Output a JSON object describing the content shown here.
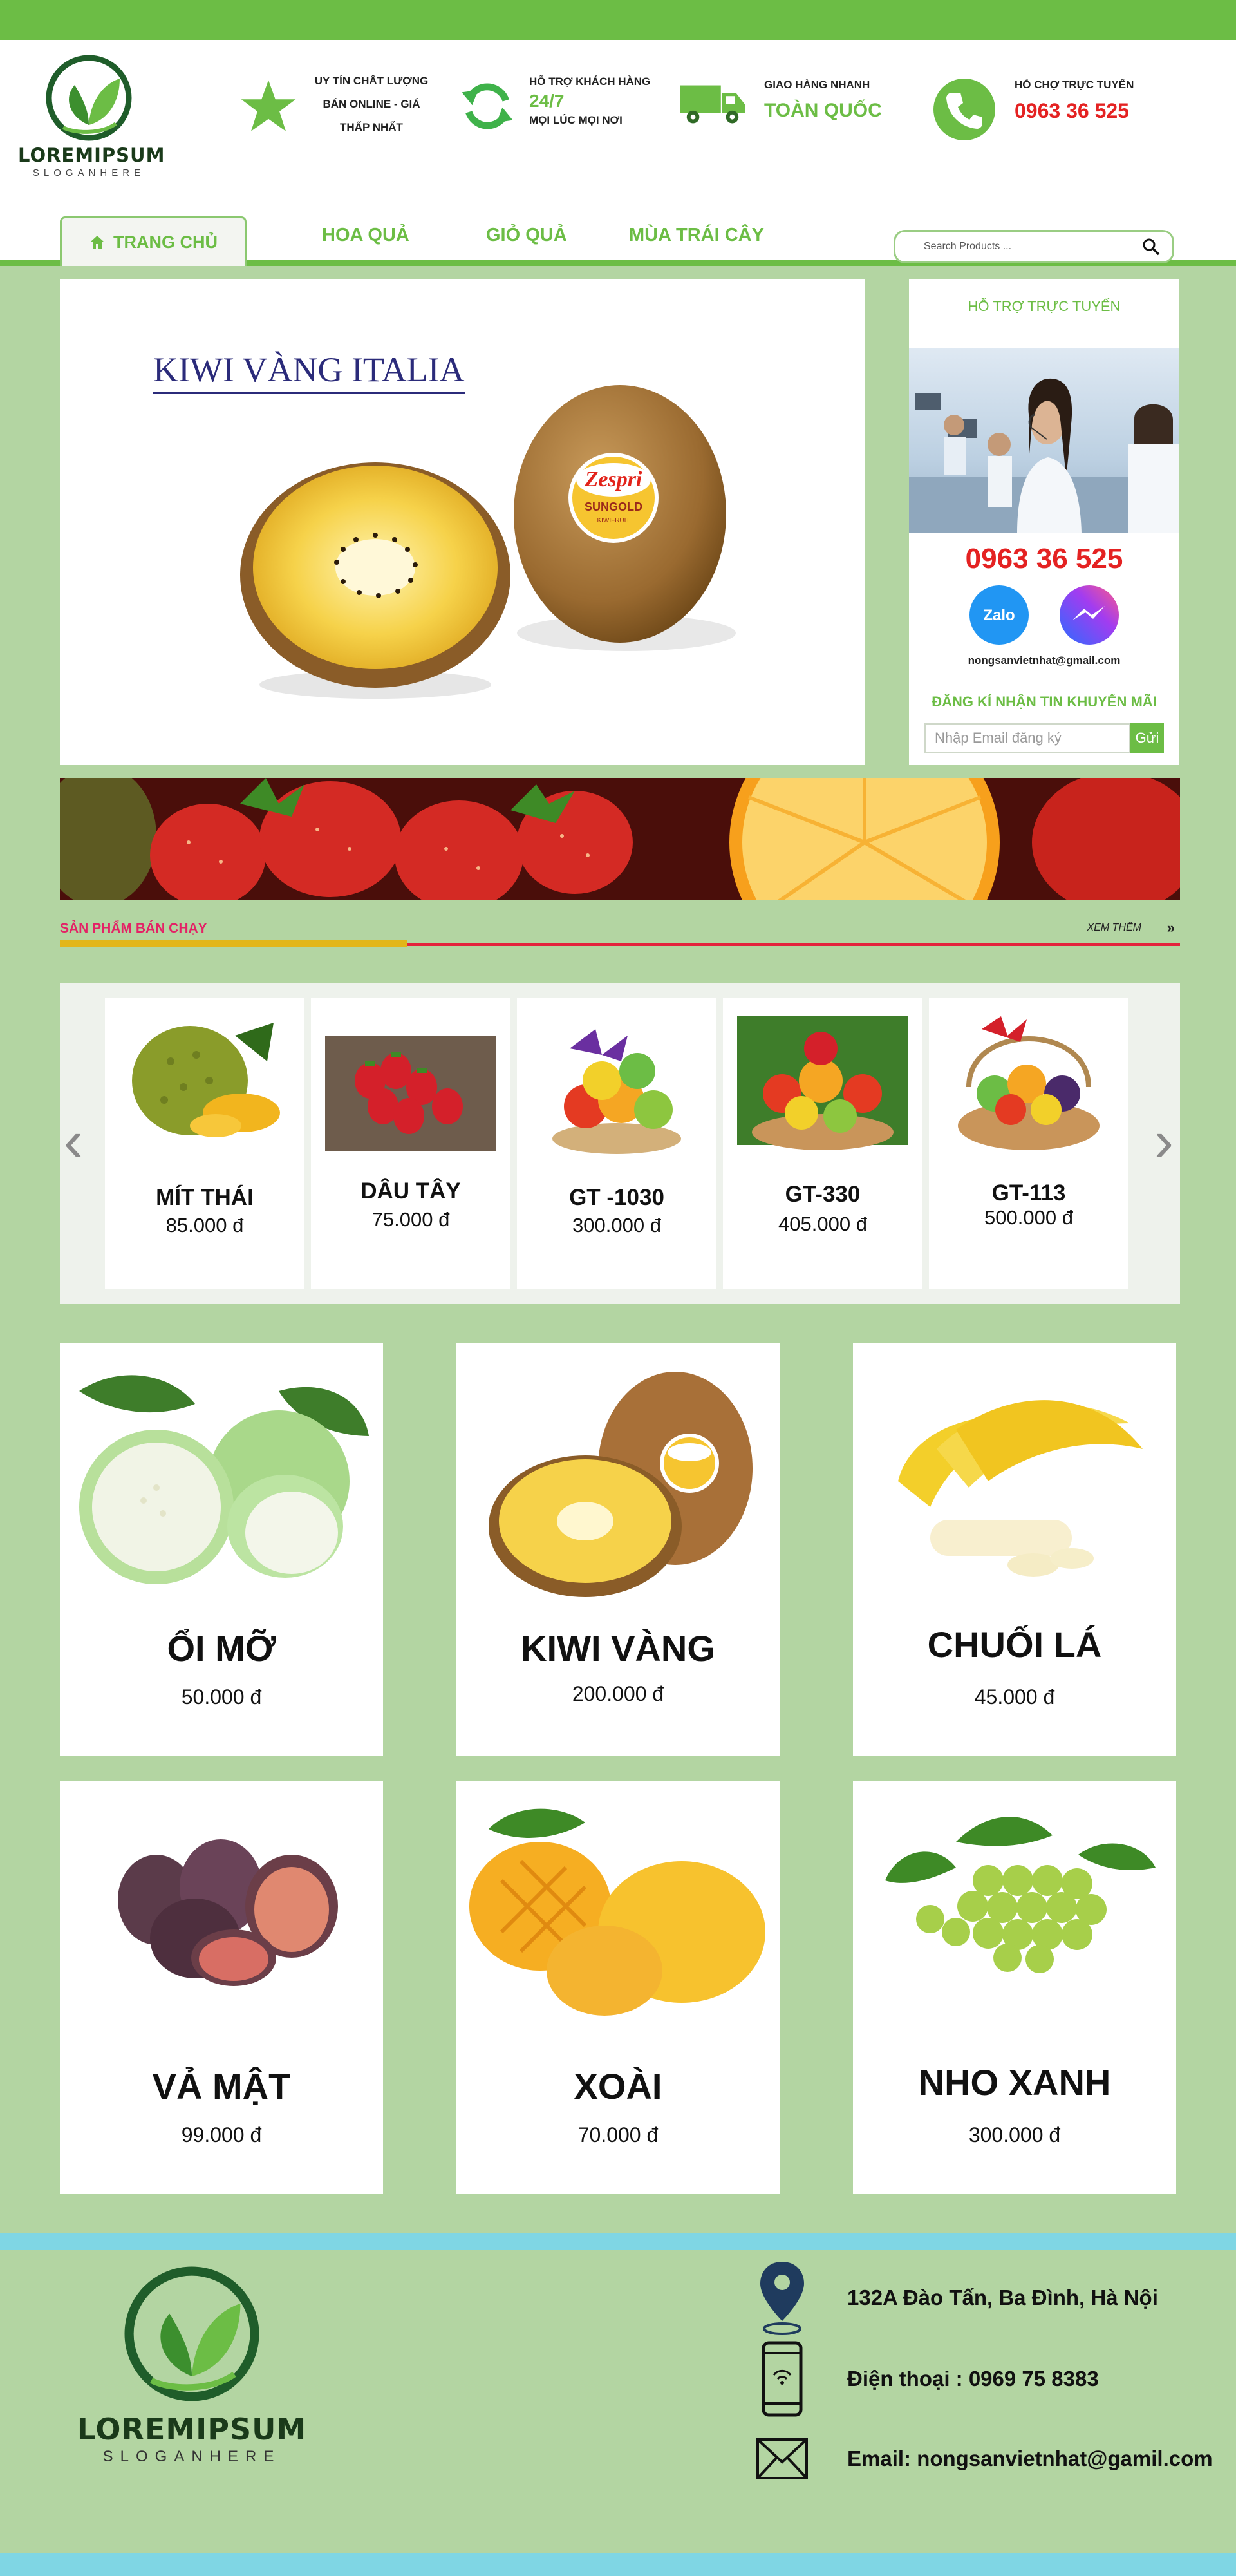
{
  "header": {
    "logo": {
      "name": "LOREMIPSUM",
      "slogan": "SLOGANHERE"
    },
    "features": [
      {
        "icon": "star-icon",
        "lines": [
          "UY TÍN CHẤT LƯỢNG",
          "BÁN ONLINE - GIÁ",
          "THẤP NHẤT"
        ]
      },
      {
        "icon": "refresh-icon",
        "line1": "HỖ TRỢ KHÁCH HÀNG",
        "big": "24/7",
        "line3": "MỌI LÚC MỌI NƠI"
      },
      {
        "icon": "truck-icon",
        "line1": "GIAO HÀNG NHANH",
        "big": "TOÀN QUỐC"
      },
      {
        "icon": "phone-icon",
        "line1": "HỖ CHỢ TRỰC TUYẾN",
        "big": "0963 36 525"
      }
    ]
  },
  "nav": {
    "home": "TRANG CHỦ",
    "items": [
      "HOA QUẢ",
      "GIỎ QUẢ",
      "MÙA TRÁI CÂY"
    ],
    "search_placeholder": "Search Products ..."
  },
  "banner": {
    "title": "KIWI VÀNG ITALIA",
    "label_brand": "Zespri",
    "label_sub": "SUNGOLD",
    "label_small": "KIWIFRUIT"
  },
  "support": {
    "title": "HỖ TRỢ TRỰC TUYẾN",
    "phone": "0963 36 525",
    "zalo": "Zalo",
    "email": "nongsanvietnhat@gmail.com",
    "subscribe_title": "ĐĂNG KÍ NHẬN TIN KHUYẾN MÃI",
    "subscribe_placeholder": "Nhập Email đăng ký",
    "subscribe_button": "Gửi"
  },
  "best_sellers": {
    "title": "SẢN PHẨM BÁN CHẠY",
    "more": "XEM THÊM",
    "more_arrow": "»",
    "prev_arrow": "‹",
    "next_arrow": "›",
    "items": [
      {
        "name": "MÍT THÁI",
        "price": "85.000 đ"
      },
      {
        "name": "DÂU TÂY",
        "price": "75.000 đ"
      },
      {
        "name": "GT -1030",
        "price": "300.000 đ"
      },
      {
        "name": "GT-330",
        "price": "405.000 đ"
      },
      {
        "name": "GT-113",
        "price": "500.000 đ"
      }
    ]
  },
  "products": [
    {
      "name": "ỔI MỠ",
      "price": "50.000 đ"
    },
    {
      "name": "KIWI VÀNG",
      "price": "200.000 đ"
    },
    {
      "name": "CHUỐI LÁ",
      "price": "45.000 đ"
    },
    {
      "name": "VẢ MẬT",
      "price": "99.000 đ"
    },
    {
      "name": "XOÀI",
      "price": "70.000 đ"
    },
    {
      "name": "NHO XANH",
      "price": "300.000 đ"
    }
  ],
  "footer": {
    "logo_name": "LOREMIPSUM",
    "logo_slogan": "SLOGANHERE",
    "address": "132A Đào Tấn, Ba Đình, Hà Nội",
    "phone": "Điện thoại : 0969 75 8383",
    "email": "Email: nongsanvietnhat@gamil.com"
  },
  "colors": {
    "brand_green": "#6cbd45",
    "page_bg": "#b3d5a2",
    "hotline_red": "#e42222",
    "accent_cyan": "#7fd6e4",
    "best_pink": "#e42266"
  }
}
